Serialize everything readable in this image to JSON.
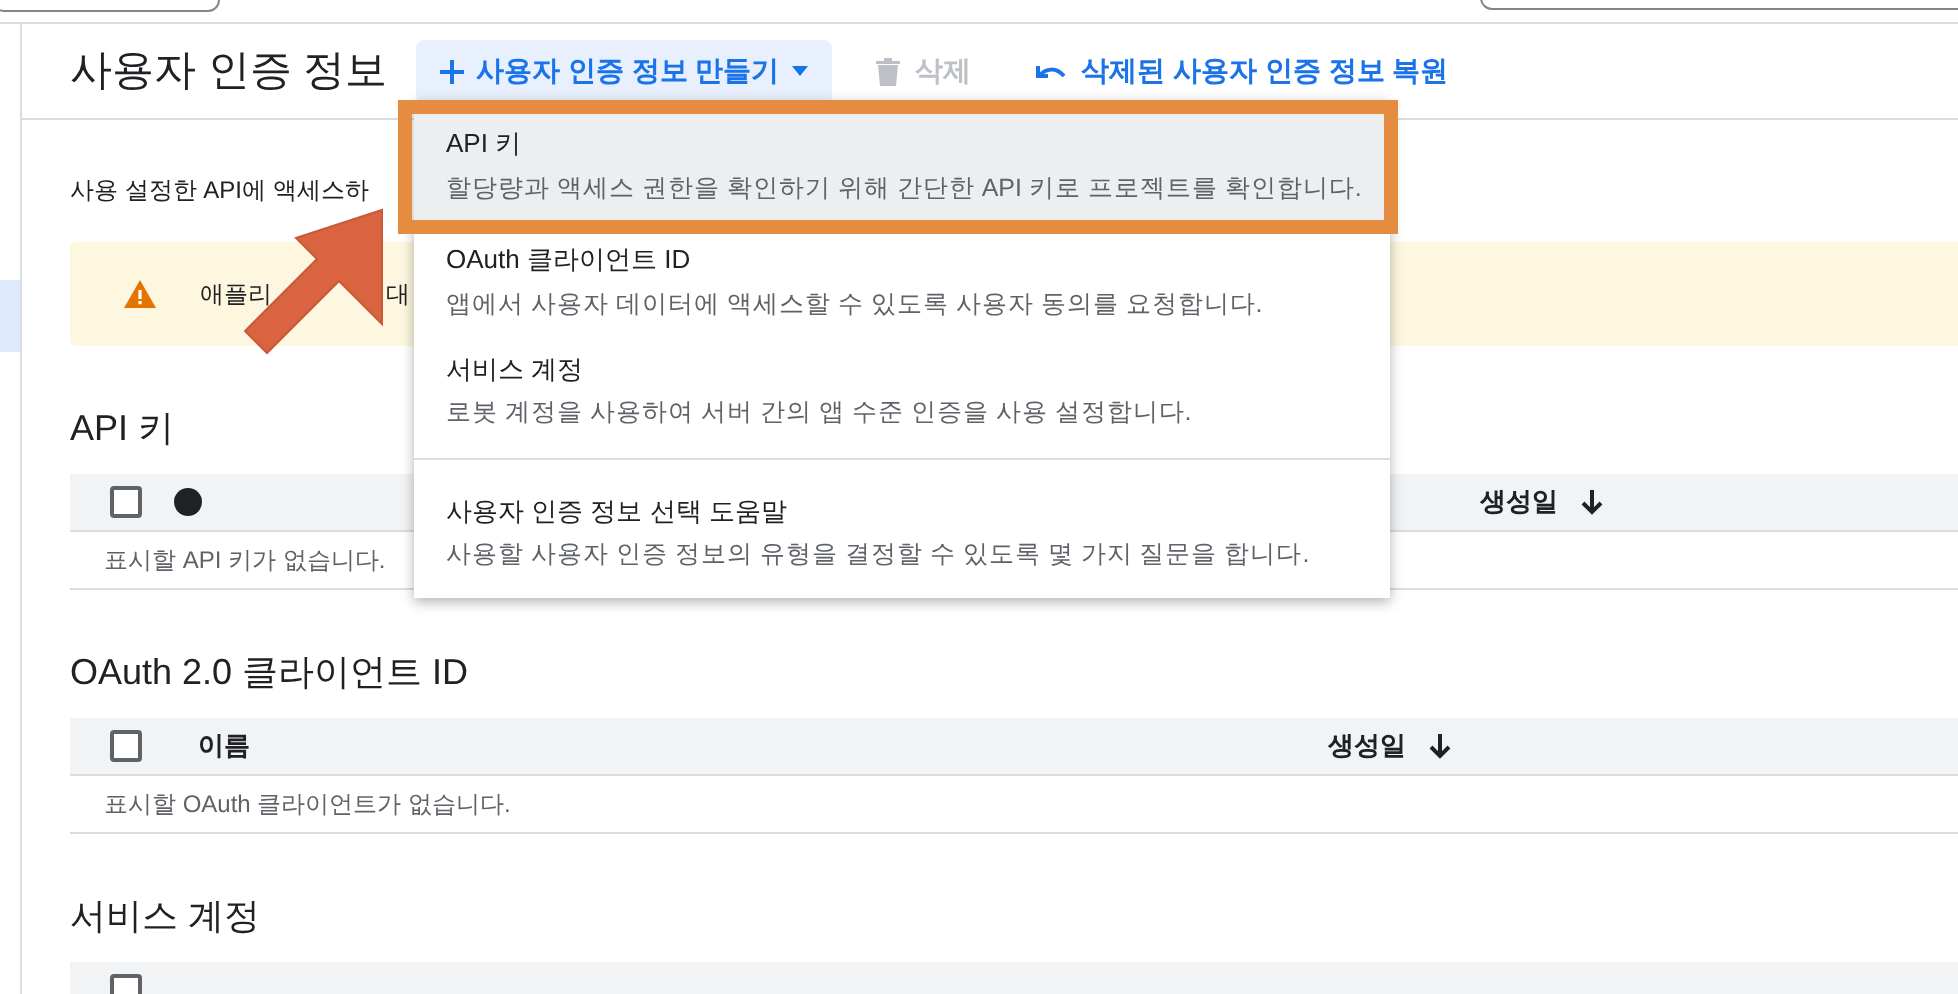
{
  "sidebar": {
    "items": [
      {
        "selected": true
      }
    ]
  },
  "header": {
    "title": "사용자 인증 정보",
    "create_button": {
      "label": "사용자 인증 정보 만들기",
      "expanded": true
    },
    "delete_button": {
      "label": "삭제",
      "disabled": true
    },
    "restore_link": "삭제된 사용자 인증 정보 복원"
  },
  "description": "사용 설정한 API에 액세스하",
  "warning": [
    "애플리",
    "대"
  ],
  "sections": [
    {
      "title": "API 키",
      "columns": [
        {
          "kind": "checkbox",
          "checked": false
        },
        {
          "kind": "dot"
        },
        {
          "kind": "text",
          "label": "생성일",
          "sorted": true
        }
      ],
      "empty": "표시할 API 키가 없습니다."
    },
    {
      "title": "OAuth 2.0 클라이언트 ID",
      "columns": [
        {
          "kind": "checkbox",
          "checked": false
        },
        {
          "kind": "text",
          "label": "이름",
          "sorted": false
        },
        {
          "kind": "text",
          "label": "생성일",
          "sorted": true
        }
      ],
      "empty": "표시할 OAuth 클라이언트가 없습니다."
    },
    {
      "title": "서비스 계정",
      "columns": [
        {
          "kind": "checkbox",
          "checked": false
        }
      ]
    }
  ],
  "menu": {
    "items": [
      {
        "title": "API 키",
        "description": "할당량과 액세스 권한을 확인하기 위해 간단한 API 키로 프로젝트를 확인합니다.",
        "selected": true,
        "divider": false
      },
      {
        "title": "OAuth 클라이언트 ID",
        "description": "앱에서 사용자 데이터에 액세스할 수 있도록 사용자 동의를 요청합니다.",
        "selected": false,
        "divider": false
      },
      {
        "title": "서비스 계정",
        "description": "로봇 계정을 사용하여 서버 간의 앱 수준 인증을 사용 설정합니다.",
        "selected": false,
        "divider": false
      },
      {
        "title": "사용자 인증 정보 선택 도움말",
        "description": "사용할 사용자 인증 정보의 유형을 결정할 수 있도록 몇 가지 질문을 합니다.",
        "selected": false,
        "divider": true
      }
    ]
  }
}
